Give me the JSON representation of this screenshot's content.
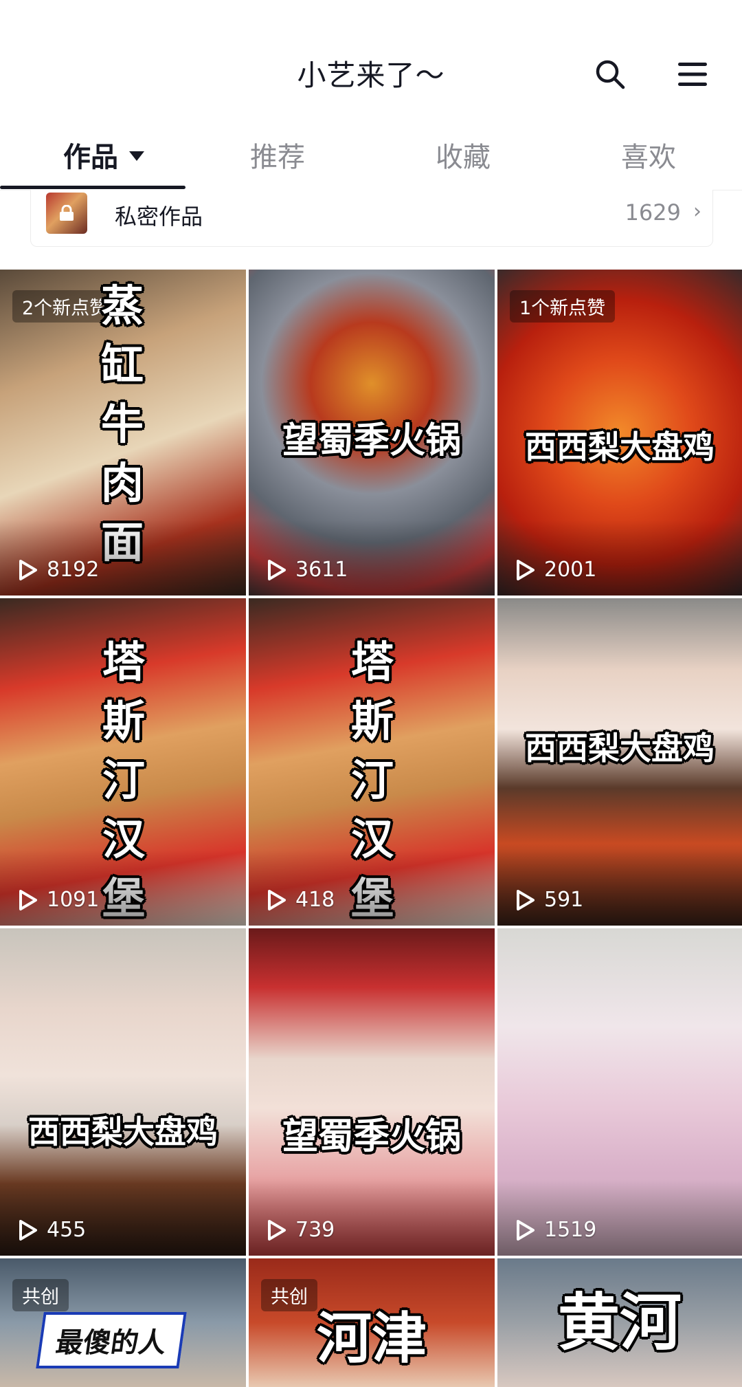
{
  "header": {
    "title": "小艺来了～"
  },
  "tabs": [
    {
      "label": "作品"
    },
    {
      "label": "推荐"
    },
    {
      "label": "收藏"
    },
    {
      "label": "喜欢"
    }
  ],
  "private": {
    "label": "私密作品",
    "count": "1629"
  },
  "tiles": [
    {
      "badge": "2个新点赞",
      "overlay": "蒸缸牛肉面",
      "views": "8192"
    },
    {
      "badge": "",
      "overlay": "望蜀季火锅",
      "views": "3611"
    },
    {
      "badge": "1个新点赞",
      "overlay": "西西梨大盘鸡",
      "views": "2001"
    },
    {
      "badge": "",
      "overlay": "塔斯汀汉堡",
      "views": "1091"
    },
    {
      "badge": "",
      "overlay": "塔斯汀汉堡",
      "views": "418"
    },
    {
      "badge": "",
      "overlay": "西西梨大盘鸡",
      "views": "591"
    },
    {
      "badge": "",
      "overlay": "西西梨大盘鸡",
      "views": "455"
    },
    {
      "badge": "",
      "overlay": "望蜀季火锅",
      "views": "739"
    },
    {
      "badge": "",
      "overlay": "",
      "views": "1519"
    },
    {
      "badge": "共创",
      "overlay": "最傻的人",
      "views": ""
    },
    {
      "badge": "共创",
      "overlay": "河津",
      "views": ""
    },
    {
      "badge": "",
      "overlay": "黄河",
      "views": ""
    }
  ],
  "colors": {
    "text": "#161823",
    "muted": "#8a8b91",
    "divider": "#ededed"
  },
  "icons": [
    "search-icon",
    "menu-icon",
    "lock-icon",
    "chevron-right-icon",
    "play-icon",
    "dropdown-arrow-icon"
  ]
}
